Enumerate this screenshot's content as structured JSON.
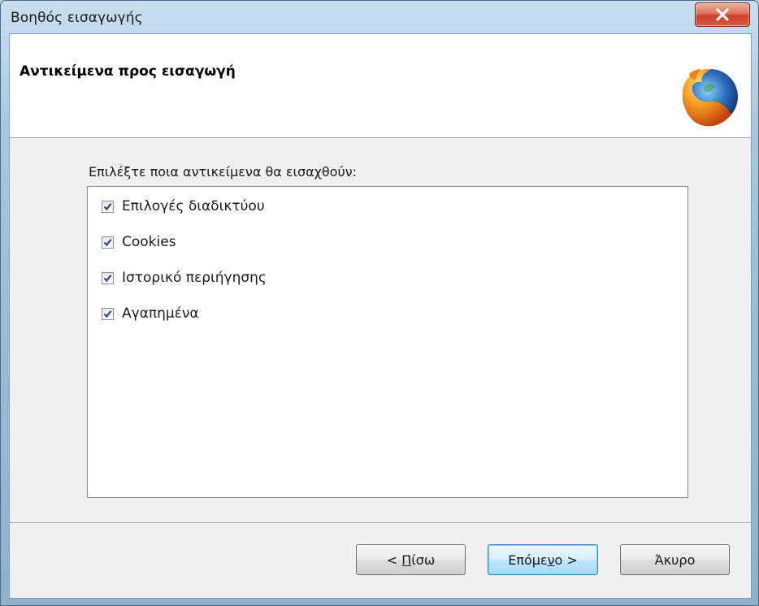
{
  "window": {
    "title": "Βοηθός εισαγωγής",
    "close_icon": "close-icon"
  },
  "header": {
    "title": "Αντικείμενα προς εισαγωγή",
    "logo_icon": "firefox-logo-icon"
  },
  "main": {
    "prompt": "Επιλέξτε ποια αντικείμενα θα εισαχθούν:",
    "items": [
      {
        "label": "Επιλογές διαδικτύου",
        "checked": true
      },
      {
        "label": "Cookies",
        "checked": true
      },
      {
        "label": "Ιστορικό περιήγησης",
        "checked": true
      },
      {
        "label": "Αγαπημένα",
        "checked": true
      }
    ]
  },
  "buttons": {
    "back_prefix": "< ",
    "back_mnemonic": "Π",
    "back_rest": "ίσω",
    "next_prefix": "Επόμε",
    "next_mnemonic": "ν",
    "next_rest": "ο >",
    "cancel": "Άκυρο"
  },
  "colors": {
    "close_button": "#c9412a",
    "default_button_border": "#3c7fb1",
    "checkmark": "#2b4c8c"
  }
}
